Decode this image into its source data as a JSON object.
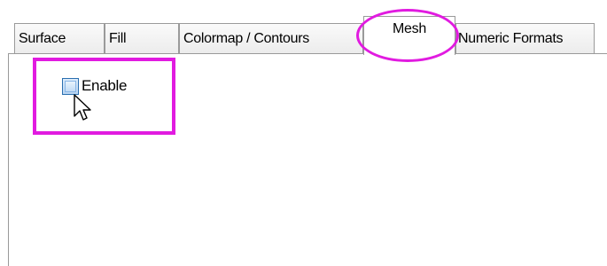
{
  "tabs": [
    {
      "label": "Surface",
      "active": false
    },
    {
      "label": "Fill",
      "active": false
    },
    {
      "label": "Colormap / Contours",
      "active": false
    },
    {
      "label": "Mesh",
      "active": true
    },
    {
      "label": "Numeric Formats",
      "active": false
    }
  ],
  "mesh": {
    "enable_label": "Enable",
    "enable_checked": false
  },
  "highlight_color": "#e11be0",
  "icons": {
    "cursor": "arrow-cursor-icon"
  }
}
